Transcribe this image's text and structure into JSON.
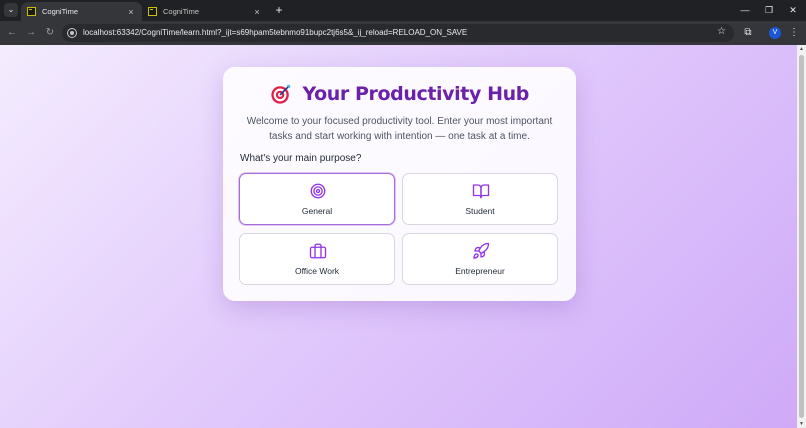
{
  "browser": {
    "tabs": [
      {
        "title": "CogniTime",
        "active": true,
        "close": "×"
      },
      {
        "title": "CogniTime",
        "active": false,
        "close": "×"
      }
    ],
    "new_tab": "+",
    "url": "localhost:63342/CogniTime/learn.html?_ijt=s69hpam5tebnmo91bupc2tj6s5&_ij_reload=RELOAD_ON_SAVE",
    "profile_initial": "V",
    "window_controls": {
      "minimize": "—",
      "restore": "❐",
      "close": "✕"
    },
    "nav": {
      "back": "←",
      "forward": "→",
      "reload": "↻"
    },
    "bookmark_icon": "☆",
    "extensions_icon": "⧉",
    "menu_icon": "⋮",
    "tab_search": "⌄"
  },
  "page": {
    "title": "Your Productivity Hub",
    "title_icon": "target-icon",
    "intro": "Welcome to your focused productivity tool. Enter your most important tasks and start working with intention — one task at a time.",
    "question": "What's your main purpose?",
    "options": [
      {
        "label": "General",
        "icon": "target-icon",
        "selected": true
      },
      {
        "label": "Student",
        "icon": "book-open-icon",
        "selected": false
      },
      {
        "label": "Office Work",
        "icon": "briefcase-icon",
        "selected": false
      },
      {
        "label": "Entrepreneur",
        "icon": "rocket-icon",
        "selected": false
      }
    ]
  },
  "colors": {
    "accent": "#6b21a8",
    "icon": "#9333ea",
    "selected_border": "#a76ad9",
    "background_start": "#f4ecfe",
    "background_end": "#cfaaf8"
  }
}
